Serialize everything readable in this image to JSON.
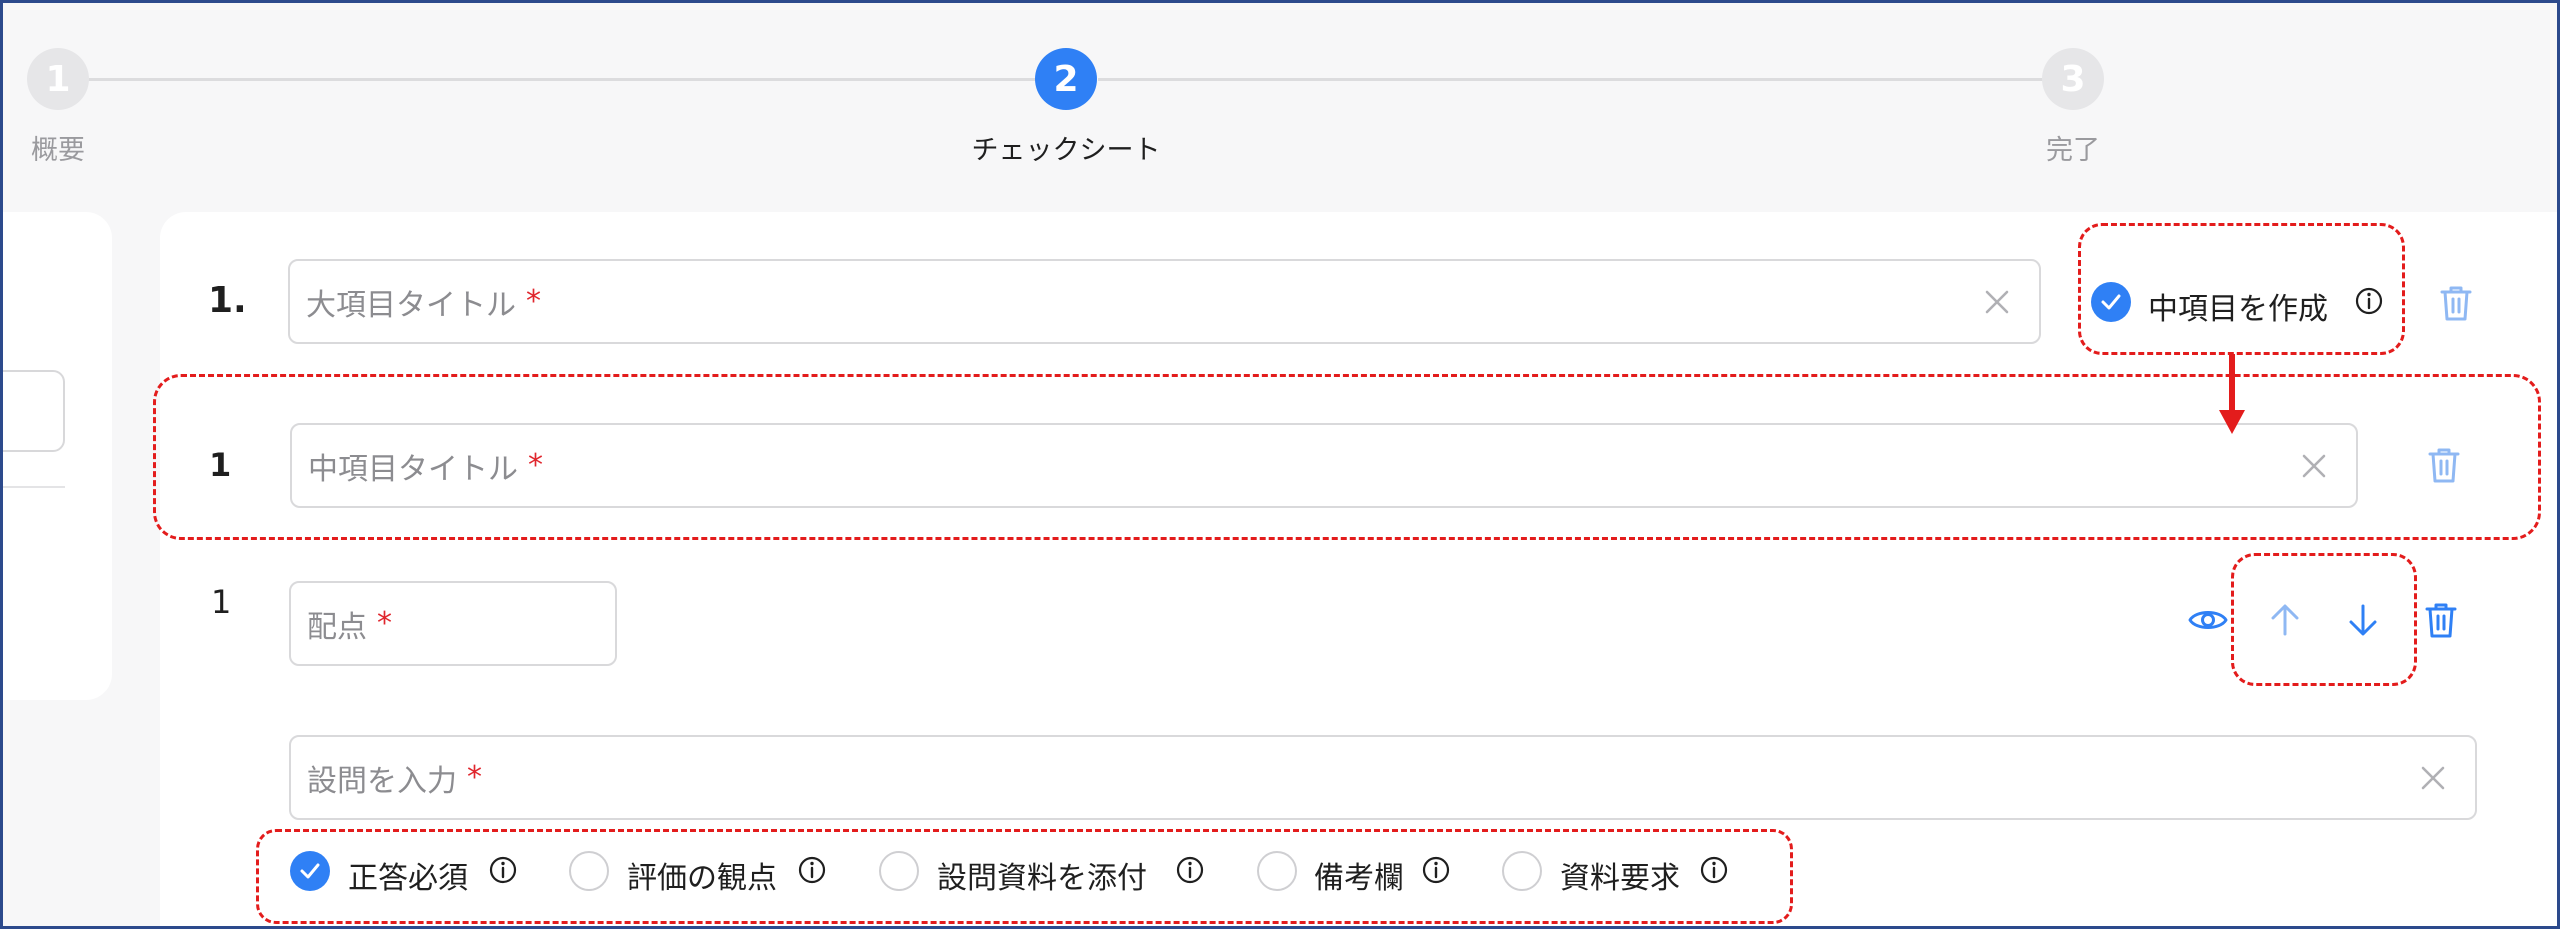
{
  "stepper": {
    "steps": [
      {
        "number": "1",
        "label": "概要",
        "state": "inactive"
      },
      {
        "number": "2",
        "label": "チェックシート",
        "state": "active"
      },
      {
        "number": "3",
        "label": "完了",
        "state": "inactive"
      }
    ]
  },
  "major_item": {
    "number": "1.",
    "title_placeholder": "大項目タイトル",
    "required_mark": "*",
    "create_sub_item": {
      "label": "中項目を作成",
      "checked": true
    }
  },
  "sub_item": {
    "number": "1",
    "title_placeholder": "中項目タイトル",
    "required_mark": "*"
  },
  "question": {
    "number": "1",
    "points_placeholder": "配点",
    "question_placeholder": "設問を入力",
    "required_mark": "*",
    "options": [
      {
        "label": "正答必須",
        "checked": true
      },
      {
        "label": "評価の観点",
        "checked": false
      },
      {
        "label": "設問資料を添付",
        "checked": false
      },
      {
        "label": "備考欄",
        "checked": false
      },
      {
        "label": "資料要求",
        "checked": false
      }
    ]
  },
  "icons": {
    "clear": "close-icon",
    "delete": "trash-icon",
    "preview": "eye-icon",
    "move_up": "arrow-up-icon",
    "move_down": "arrow-down-icon",
    "info": "info-icon",
    "check": "check-icon"
  },
  "colors": {
    "accent": "#2f80f5",
    "annotation": "#e31c1c",
    "required": "#e0262d",
    "icon_light": "#8fb8f3"
  }
}
